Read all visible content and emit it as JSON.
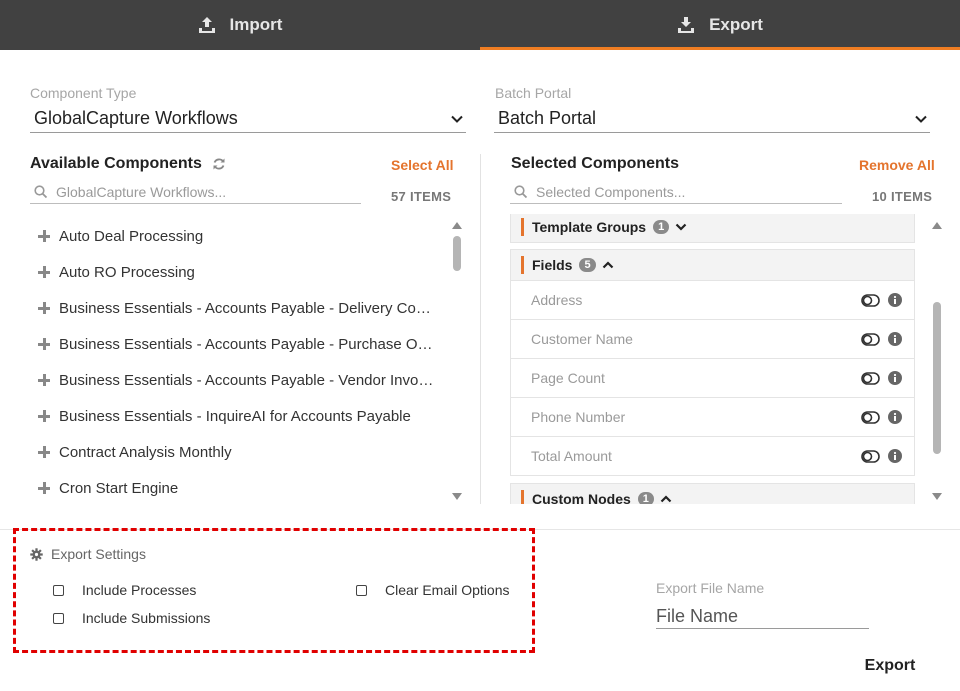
{
  "tabs": [
    {
      "label": "Import",
      "icon": "upload-icon",
      "active": false
    },
    {
      "label": "Export",
      "icon": "download-icon",
      "active": true
    }
  ],
  "accent_color": "#e4742d",
  "component_type": {
    "label": "Component Type",
    "value": "GlobalCapture Workflows"
  },
  "batch_portal": {
    "label": "Batch Portal",
    "value": "Batch Portal"
  },
  "available": {
    "title": "Available Components",
    "select_all": "Select All",
    "search_placeholder": "GlobalCapture Workflows...",
    "count": "57 ITEMS",
    "items": [
      "Auto Deal Processing",
      "Auto RO Processing",
      "Business Essentials - Accounts Payable - Delivery Co…",
      "Business Essentials - Accounts Payable - Purchase O…",
      "Business Essentials - Accounts Payable - Vendor Invo…",
      "Business Essentials - InquireAI for Accounts Payable",
      "Contract Analysis Monthly",
      "Cron Start Engine"
    ]
  },
  "selected": {
    "title": "Selected Components",
    "remove_all": "Remove All",
    "search_placeholder": "Selected Components...",
    "count": "10 ITEMS",
    "groups": [
      {
        "name": "Template Groups",
        "count": "1",
        "expanded": false
      },
      {
        "name": "Fields",
        "count": "5",
        "expanded": true,
        "fields": [
          "Address",
          "Customer Name",
          "Page Count",
          "Phone Number",
          "Total Amount"
        ]
      },
      {
        "name": "Custom Nodes",
        "count": "1",
        "expanded": true
      }
    ]
  },
  "export_settings": {
    "title": "Export Settings",
    "include_processes": "Include Processes",
    "include_submissions": "Include Submissions",
    "clear_email_options": "Clear Email Options"
  },
  "export_file": {
    "label": "Export File Name",
    "placeholder": "File Name"
  },
  "export_button": "Export"
}
